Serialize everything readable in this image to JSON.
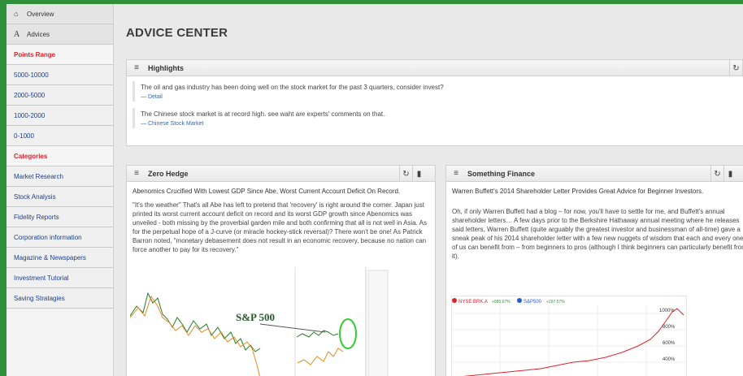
{
  "sidebar": {
    "items": [
      {
        "label": "Overview",
        "icon": "home-icon",
        "glyph": "⌂",
        "type": "nav"
      },
      {
        "label": "Advices",
        "icon": "advices-icon",
        "glyph": "A",
        "type": "nav"
      },
      {
        "label": "Points Range",
        "type": "heading"
      },
      {
        "label": "5000-10000",
        "type": "link"
      },
      {
        "label": "2000-5000",
        "type": "link"
      },
      {
        "label": "1000-2000",
        "type": "link"
      },
      {
        "label": "0-1000",
        "type": "link"
      },
      {
        "label": "Categories",
        "type": "heading"
      },
      {
        "label": "Market Research",
        "type": "link"
      },
      {
        "label": "Stock Analysis",
        "type": "link"
      },
      {
        "label": "Fidelity Reports",
        "type": "link"
      },
      {
        "label": "Corporation information",
        "type": "link"
      },
      {
        "label": "Magazine & Newspapers",
        "type": "link"
      },
      {
        "label": "Investment Tutorial",
        "type": "link"
      },
      {
        "label": "Saving Stratagies",
        "type": "link"
      }
    ]
  },
  "page": {
    "title": "ADVICE CENTER"
  },
  "highlights": {
    "title": "Highlights",
    "items": [
      {
        "text": "The oil and gas industry has been doing well on the stock market for the past 3 quarters, consider invest?",
        "source": "— Detail"
      },
      {
        "text": "The Chinese stock market is at record high. see waht are experts' comments on that.",
        "source": "— Chinese Stock Market"
      }
    ]
  },
  "zero_hedge": {
    "title": "Zero Hedge",
    "headline": "Abenomics Crucified With Lowest GDP Since Abe, Worst Current Account Deficit On Record.",
    "text": "\"It's the weather\" That's all Abe has left to pretend that 'recovery' is right around the corner. Japan just printed its worst current account deficit on record and its worst GDP growth since Abenomics was unveiled - both missing by the proverbial garden mile and both confirming that all is not well in Asia. As for the perpetual hope of a J-curve (or miracle hockey-stick reversal)? There won't be one! As Patrick Barron noted, \"monetary debasement does not result in an economic recovery, because no nation can force another to pay for its recovery.\"",
    "chart_label": "S&P 500"
  },
  "something_finance": {
    "title": "Something Finance",
    "headline": "Warren Buffett's 2014 Shareholder Letter Provides Great Advice for Beginner Investors.",
    "text": "Oh, if only Warren Buffett had a blog – for now, you'll have to settle for me, and Buffett's annual shareholder letters… A few days prior to the Berkshire Hathaway annual meeting where he releases said letters, Warren Buffett (quite arguably the greatest investor and businessman of all-time) gave a sneak peak of his 2014 shareholder letter with a few new nuggets of wisdom that each and every one of us can benefit from – from beginners to pros (although I think beginners can particularly benefit from it).",
    "legend": [
      {
        "name": "NYSE:BRK.A",
        "value": "+985.67%",
        "color": "#e0222a"
      },
      {
        "name": "S&P500",
        "value": "+297.57%",
        "color": "#2a5ad0"
      }
    ],
    "ticks": [
      "1000%",
      "800%",
      "600%",
      "400%"
    ]
  },
  "icons": {
    "menu": "≡",
    "refresh": "↻",
    "trash": "▮"
  },
  "colors": {
    "accent_green": "#2f8f3b",
    "heading_red": "#e0222a",
    "link_blue": "#1a3f8c"
  }
}
